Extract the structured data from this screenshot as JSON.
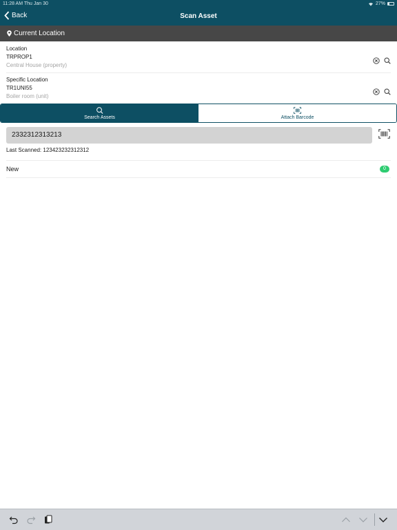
{
  "status_bar": {
    "time": "11:28 AM   Thu Jan 30",
    "battery": "27%"
  },
  "nav": {
    "back_label": "Back",
    "title": "Scan Asset"
  },
  "section": {
    "title": "Current Location"
  },
  "location": {
    "label": "Location",
    "code": "TRPROP1",
    "description": "Central House (property)"
  },
  "specific_location": {
    "label": "Specific Location",
    "code": "TR1UNI55",
    "description": "Boiler room (unit)"
  },
  "tabs": [
    {
      "label": "Search Assets",
      "icon": "search-icon",
      "active": true
    },
    {
      "label": "Attach Barcode",
      "icon": "barcode-icon",
      "active": false
    }
  ],
  "scan": {
    "value": "2332312313213",
    "last_scanned": "Last Scanned: 123423232312312"
  },
  "list": [
    {
      "label": "New",
      "count": "0"
    }
  ],
  "colors": {
    "brand": "#0d4f63",
    "header_gray": "#474747",
    "badge_green": "#2ecc71",
    "input_bg": "#d3d3d3"
  }
}
